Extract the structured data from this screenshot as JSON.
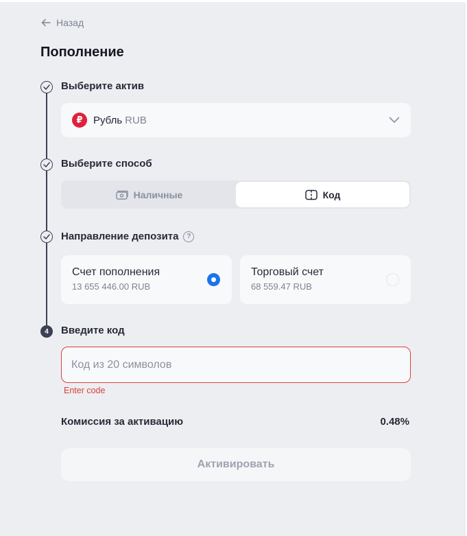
{
  "nav": {
    "back_label": "Назад"
  },
  "page": {
    "title": "Пополнение"
  },
  "steps": {
    "asset": {
      "label": "Выберите актив",
      "selected_name": "Рубль",
      "selected_code": "RUB",
      "icon_glyph": "₽"
    },
    "method": {
      "label": "Выберите способ",
      "options": [
        {
          "label": "Наличные",
          "selected": false
        },
        {
          "label": "Код",
          "selected": true
        }
      ]
    },
    "direction": {
      "label": "Направление депозита",
      "help_glyph": "?",
      "accounts": [
        {
          "title": "Счет пополнения",
          "balance": "13 655 446.00 RUB",
          "selected": true
        },
        {
          "title": "Торговый счет",
          "balance": "68 559.47 RUB",
          "selected": false
        }
      ]
    },
    "code": {
      "number": "4",
      "label": "Введите код",
      "value": "",
      "placeholder": "Код из 20 символов",
      "error": "Enter code"
    }
  },
  "fee": {
    "label": "Комиссия за активацию",
    "value": "0.48%"
  },
  "actions": {
    "activate_label": "Активировать"
  },
  "colors": {
    "accent": "#1a73f0",
    "error": "#d8413c",
    "ruble_icon": "#e0213b",
    "background": "#eceef2"
  }
}
